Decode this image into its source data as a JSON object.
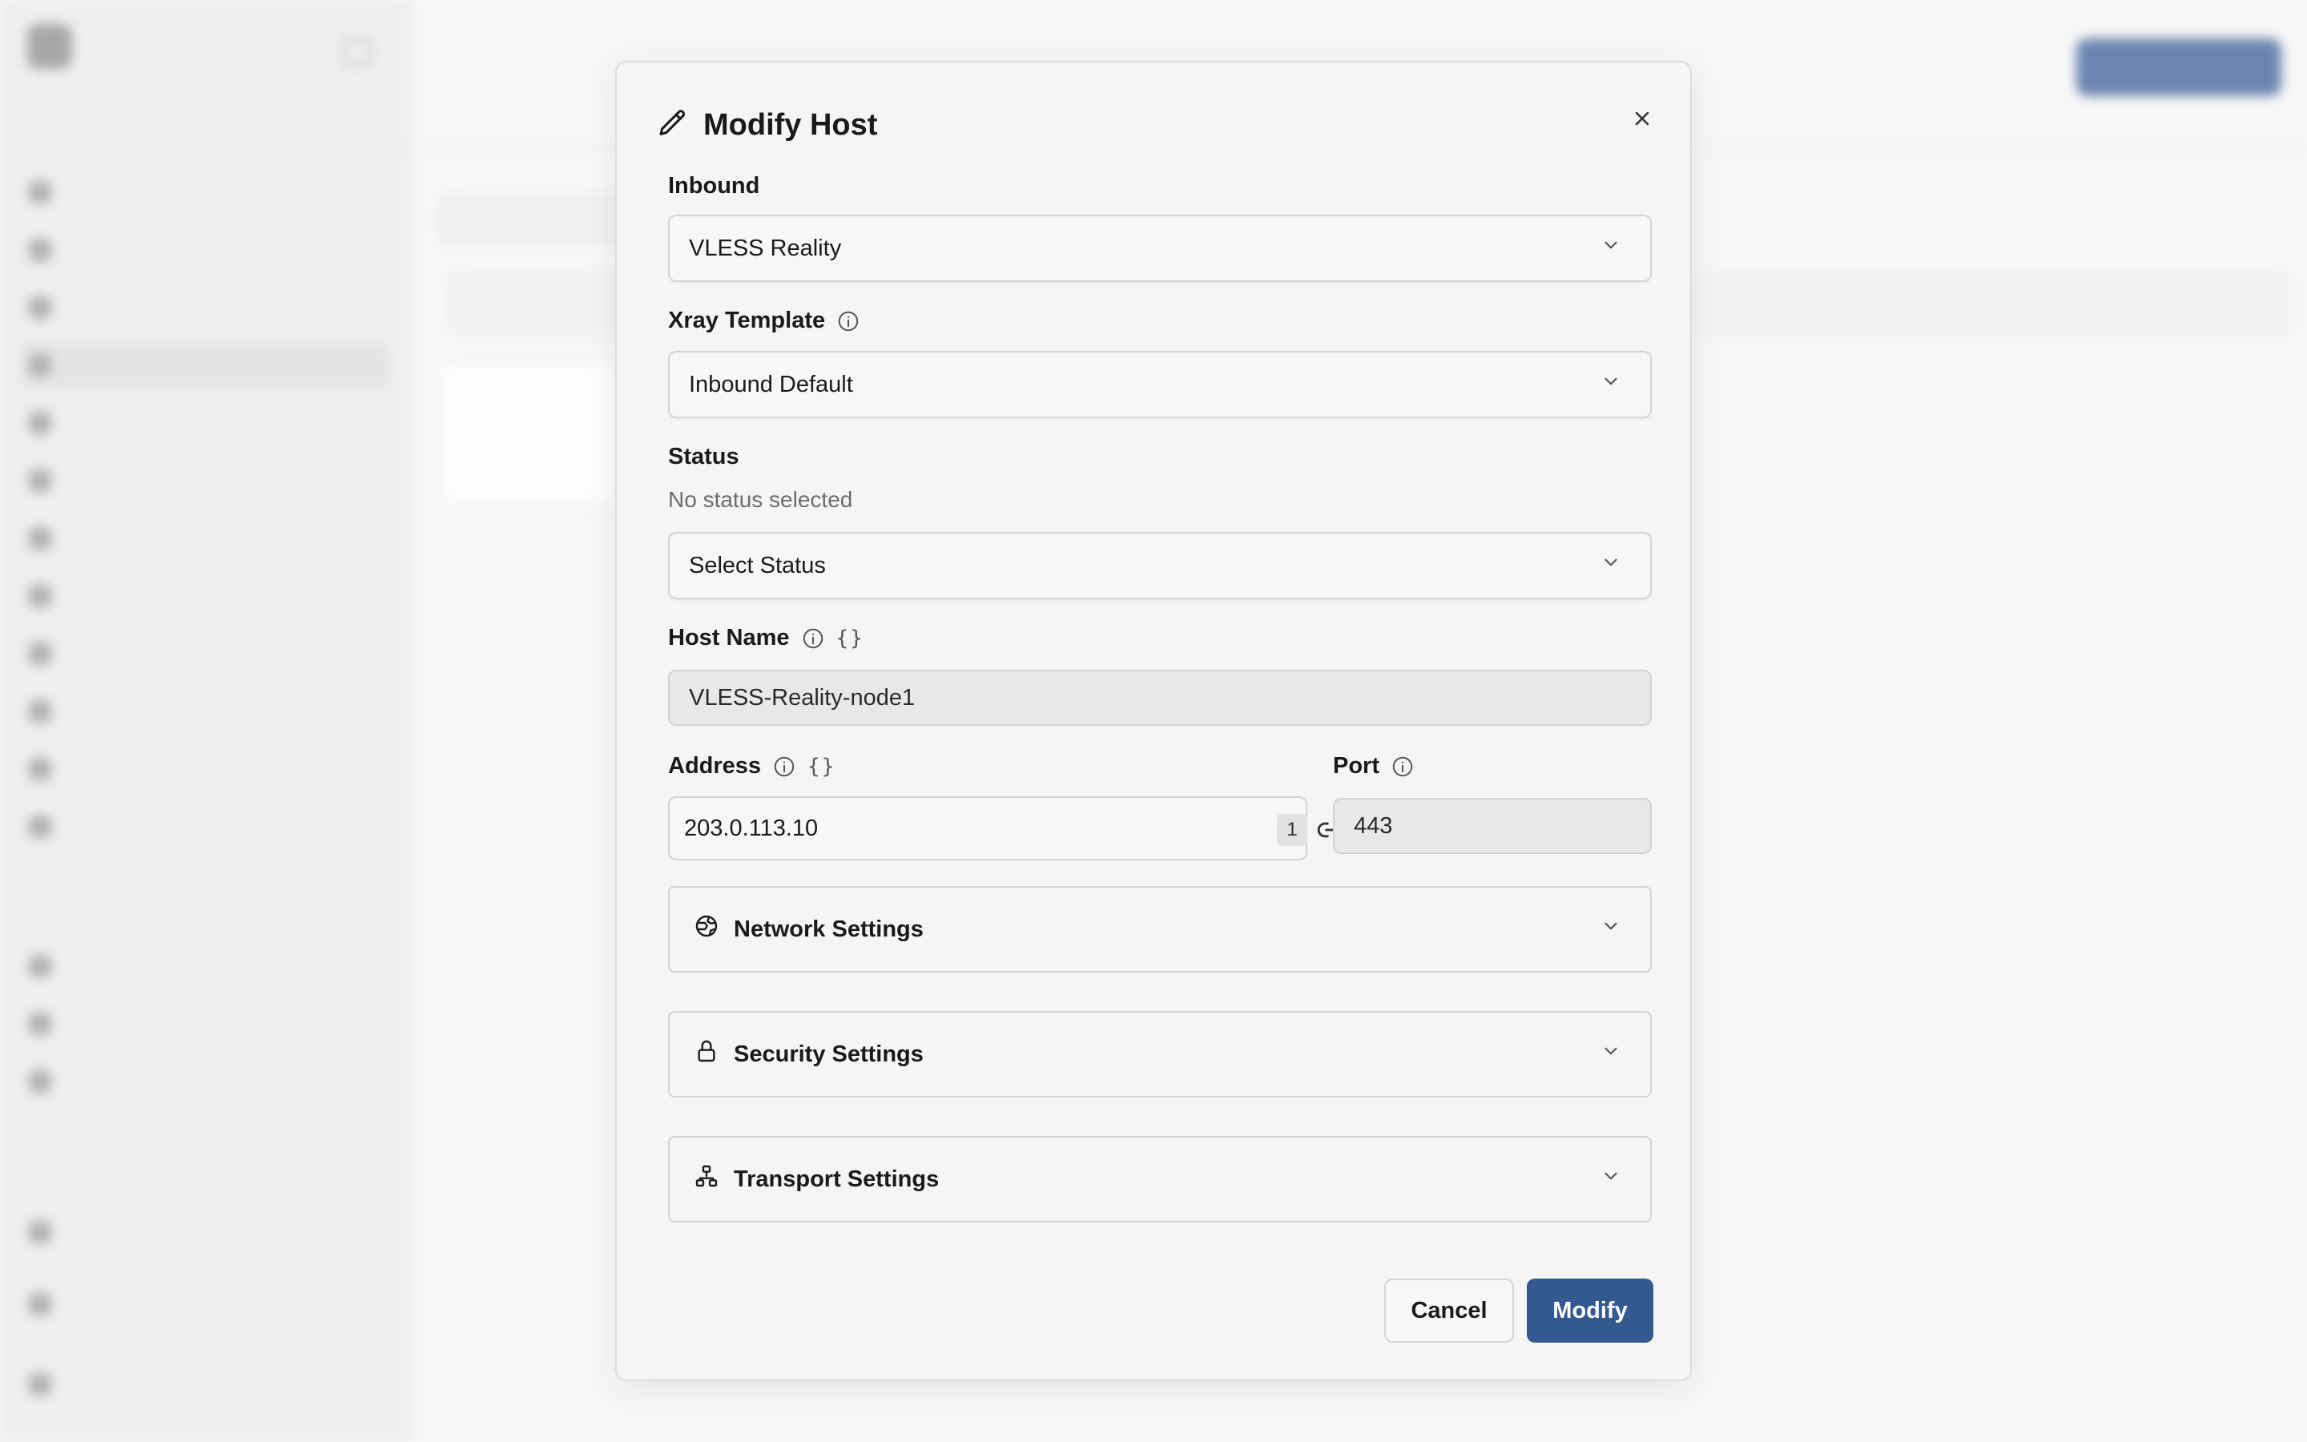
{
  "modal": {
    "title": "Modify Host",
    "inbound": {
      "label": "Inbound",
      "value": "VLESS Reality"
    },
    "xray_template": {
      "label": "Xray Template",
      "value": "Inbound Default"
    },
    "status": {
      "label": "Status",
      "hint": "No status selected",
      "value": "Select Status"
    },
    "host_name": {
      "label": "Host Name",
      "value": "VLESS-Reality-node1"
    },
    "address": {
      "label": "Address",
      "value": "203.0.113.10",
      "count": "1"
    },
    "port": {
      "label": "Port",
      "value": "443"
    },
    "sections": {
      "network": "Network Settings",
      "security": "Security Settings",
      "transport": "Transport Settings"
    },
    "buttons": {
      "cancel": "Cancel",
      "modify": "Modify"
    }
  },
  "colors": {
    "primary": "#33598f",
    "background": "#f5f5f5",
    "border": "#d4d4d4"
  },
  "icons": {
    "title": "pencil-icon",
    "close": "close-icon",
    "info": "info-icon",
    "template": "braces-icon",
    "link": "link-icon",
    "network": "globe-icon",
    "security": "lock-icon",
    "transport": "network-tree-icon",
    "dropdown": "chevron-down-icon"
  }
}
